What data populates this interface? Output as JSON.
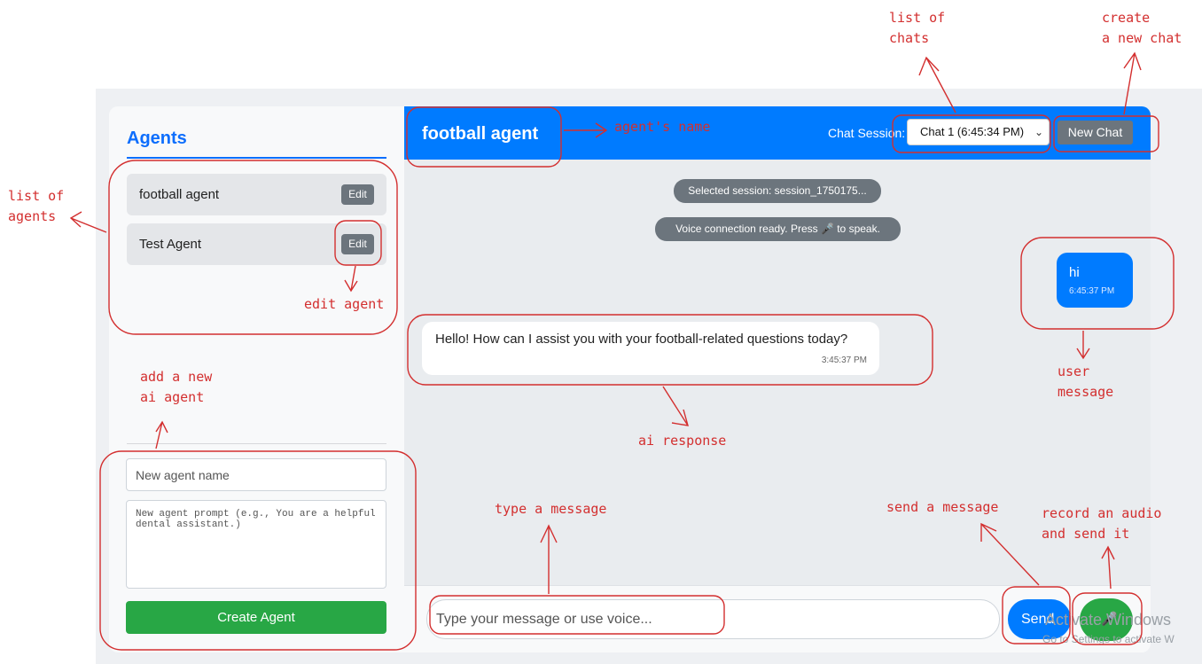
{
  "sidebar": {
    "title": "Agents",
    "agents": [
      {
        "name": "football agent",
        "edit_label": "Edit"
      },
      {
        "name": "Test Agent",
        "edit_label": "Edit"
      }
    ],
    "new_agent": {
      "name_placeholder": "New agent name",
      "prompt_placeholder": "New agent prompt (e.g., You are a helpful dental assistant.)",
      "create_label": "Create Agent"
    }
  },
  "chat": {
    "agent_name": "football agent",
    "session_label": "Chat Session:",
    "session_selected": "Chat 1 (6:45:34 PM)",
    "new_chat_label": "New Chat",
    "system_messages": [
      "Selected session: session_1750175...",
      "Voice connection ready. Press 🎤 to speak."
    ],
    "messages": [
      {
        "role": "user",
        "text": "hi",
        "time": "6:45:37 PM"
      },
      {
        "role": "ai",
        "text": "Hello! How can I assist you with your football-related questions today?",
        "time": "3:45:37 PM"
      }
    ],
    "input_placeholder": "Type your message or use voice...",
    "send_label": "Send",
    "mic_icon": "microphone-icon"
  },
  "watermark": {
    "line1": "Activate Windows",
    "line2": "Go to Settings to activate W"
  },
  "annotations": {
    "list_of_chats": "list of\nchats",
    "create_new_chat": "create\na new chat",
    "agents_name": "agent's name",
    "list_of_agents": "list of\nagents",
    "edit_agent": "edit agent",
    "add_new_agent": "add a new\nai agent",
    "user_message": "user\nmessage",
    "ai_response": "ai response",
    "type_message": "type a message",
    "send_message": "send a message",
    "record_audio": "record an audio\nand send it",
    "color": "#d32f2f"
  }
}
